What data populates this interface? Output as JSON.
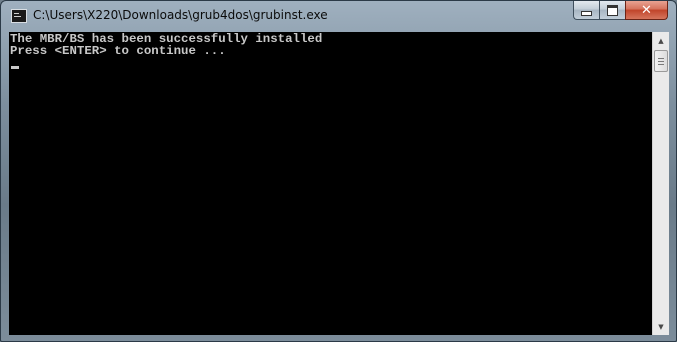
{
  "window": {
    "title": "C:\\Users\\X220\\Downloads\\grub4dos\\grubinst.exe",
    "app_icon": "console-icon",
    "buttons": {
      "minimize_icon": "minimize-icon",
      "maximize_icon": "maximize-icon",
      "close_icon": "close-icon",
      "close_glyph": "✕"
    }
  },
  "console": {
    "lines": [
      "The MBR/BS has been successfully installed",
      "Press <ENTER> to continue ..."
    ],
    "text_color": "#c8c8c8",
    "background_color": "#000000"
  },
  "scrollbar": {
    "up_glyph": "▲",
    "down_glyph": "▼"
  }
}
